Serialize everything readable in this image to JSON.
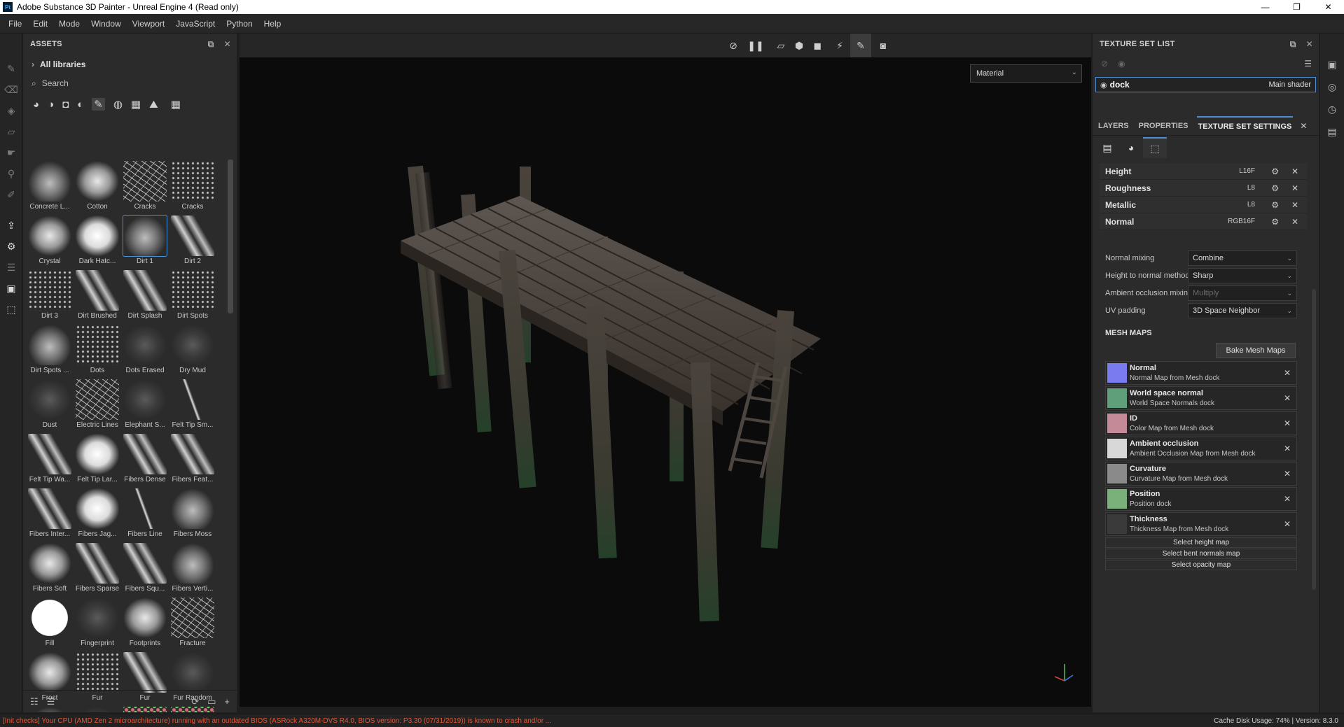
{
  "window": {
    "title": "Adobe Substance 3D Painter - Unreal Engine 4 (Read only)",
    "app_icon": "Pt",
    "minimize": "—",
    "maximize": "❐",
    "close": "✕"
  },
  "menu": [
    "File",
    "Edit",
    "Mode",
    "Window",
    "Viewport",
    "JavaScript",
    "Python",
    "Help"
  ],
  "assets": {
    "title": "ASSETS",
    "libraries": "All libraries",
    "search_placeholder": "Search",
    "items": [
      {
        "label": "Concrete L...",
        "style": "smudge"
      },
      {
        "label": "Cotton",
        "style": "soft"
      },
      {
        "label": "Cracks",
        "style": "cracks"
      },
      {
        "label": "Cracks",
        "style": "dots"
      },
      {
        "label": "Crystal",
        "style": "soft"
      },
      {
        "label": "Dark Hatc...",
        "style": "bright"
      },
      {
        "label": "Dirt 1",
        "style": "smudge"
      },
      {
        "label": "Dirt 2",
        "style": "stroke"
      },
      {
        "label": "Dirt 3",
        "style": "dots"
      },
      {
        "label": "Dirt Brushed",
        "style": "stroke"
      },
      {
        "label": "Dirt Splash",
        "style": "stroke"
      },
      {
        "label": "Dirt Spots",
        "style": "dots"
      },
      {
        "label": "Dirt Spots ...",
        "style": "smudge"
      },
      {
        "label": "Dots",
        "style": "dots"
      },
      {
        "label": "Dots Erased",
        "style": "dark"
      },
      {
        "label": "Dry Mud",
        "style": "dark"
      },
      {
        "label": "Dust",
        "style": "dark"
      },
      {
        "label": "Electric Lines",
        "style": "cracks"
      },
      {
        "label": "Elephant S...",
        "style": "dark"
      },
      {
        "label": "Felt Tip Sm...",
        "style": "line"
      },
      {
        "label": "Felt Tip Wa...",
        "style": "stroke"
      },
      {
        "label": "Felt Tip Lar...",
        "style": "bright"
      },
      {
        "label": "Fibers Dense",
        "style": "stroke"
      },
      {
        "label": "Fibers Feat...",
        "style": "stroke"
      },
      {
        "label": "Fibers Inter...",
        "style": "stroke"
      },
      {
        "label": "Fibers Jag...",
        "style": "bright"
      },
      {
        "label": "Fibers Line",
        "style": "line"
      },
      {
        "label": "Fibers Moss",
        "style": "smudge"
      },
      {
        "label": "Fibers Soft",
        "style": "soft"
      },
      {
        "label": "Fibers Sparse",
        "style": "stroke"
      },
      {
        "label": "Fibers Squ...",
        "style": "stroke"
      },
      {
        "label": "Fibers Verti...",
        "style": "smudge"
      },
      {
        "label": "Fill",
        "style": "fill"
      },
      {
        "label": "Fingerprint",
        "style": "dark"
      },
      {
        "label": "Footprints",
        "style": "soft"
      },
      {
        "label": "Fracture",
        "style": "cracks"
      },
      {
        "label": "Frost",
        "style": "soft"
      },
      {
        "label": "Fur",
        "style": "dots"
      },
      {
        "label": "Fur",
        "style": "stroke"
      },
      {
        "label": "Fur Random",
        "style": "dark"
      },
      {
        "label": "",
        "style": "smudge"
      },
      {
        "label": "",
        "style": "dark"
      },
      {
        "label": "",
        "style": "color"
      },
      {
        "label": "",
        "style": "color"
      }
    ]
  },
  "viewport": {
    "mode": "Material"
  },
  "texture_set_list": {
    "title": "TEXTURE SET LIST",
    "set_name": "dock",
    "shader": "Main shader"
  },
  "tabs": {
    "layers": "LAYERS",
    "properties": "PROPERTIES",
    "texture_set_settings": "TEXTURE SET SETTINGS"
  },
  "channels": [
    {
      "name": "Height",
      "format": "L16F"
    },
    {
      "name": "Roughness",
      "format": "L8"
    },
    {
      "name": "Metallic",
      "format": "L8"
    },
    {
      "name": "Normal",
      "format": "RGB16F"
    }
  ],
  "settings": {
    "normal_mixing_label": "Normal mixing",
    "normal_mixing_value": "Combine",
    "height_to_normal_label": "Height to normal method",
    "height_to_normal_value": "Sharp",
    "ao_mixing_label": "Ambient occlusion mixing",
    "ao_mixing_value": "Multiply",
    "uv_padding_label": "UV padding",
    "uv_padding_value": "3D Space Neighbor"
  },
  "mesh_maps": {
    "title": "MESH MAPS",
    "bake_button": "Bake Mesh Maps",
    "maps": [
      {
        "name": "Normal",
        "desc": "Normal Map from Mesh dock",
        "color": "#7b7bf0"
      },
      {
        "name": "World space normal",
        "desc": "World Space Normals dock",
        "color": "#5fa07a"
      },
      {
        "name": "ID",
        "desc": "Color Map from Mesh dock",
        "color": "#c48a98"
      },
      {
        "name": "Ambient occlusion",
        "desc": "Ambient Occlusion Map from Mesh dock",
        "color": "#d8d8d8"
      },
      {
        "name": "Curvature",
        "desc": "Curvature Map from Mesh dock",
        "color": "#8a8a8a"
      },
      {
        "name": "Position",
        "desc": "Position dock",
        "color": "#7ab07a"
      },
      {
        "name": "Thickness",
        "desc": "Thickness Map from Mesh dock",
        "color": "#3a3a3a"
      }
    ],
    "select_height": "Select height map",
    "select_bent": "Select bent normals map",
    "select_opacity": "Select opacity map"
  },
  "status": {
    "error": "[Init checks] Your CPU (AMD Zen 2 microarchitecture) running with an outdated BIOS (ASRock A320M-DVS R4.0, BIOS version: P3.30 (07/31/2019)) is known to crash and/or ...",
    "cache_label": "Cache Disk Usage:",
    "cache_value": "74%",
    "version": "Version: 8.3.0"
  },
  "colors": {
    "accent": "#4a8fd8",
    "error": "#e55a3b"
  }
}
